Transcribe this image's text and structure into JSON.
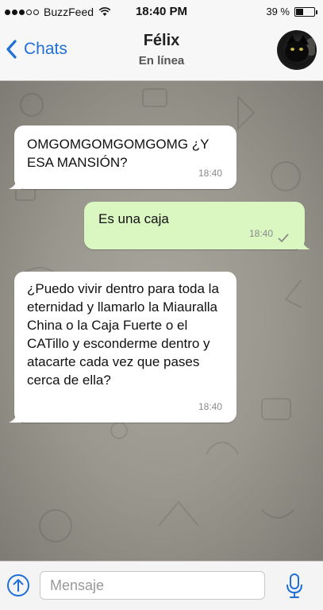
{
  "status_bar": {
    "carrier": "BuzzFeed",
    "time": "18:40 PM",
    "battery_text": "39 %",
    "battery_level": 0.39,
    "signal_bars_filled": 3,
    "signal_bars_total": 5
  },
  "nav": {
    "back_label": "Chats",
    "contact_name": "Félix",
    "contact_status": "En línea"
  },
  "messages": [
    {
      "direction": "incoming",
      "text": "OMGOMGOMGOMGOMG ¿Y ESA MANSIÓN?",
      "time": "18:40"
    },
    {
      "direction": "outgoing",
      "text": "Es una caja",
      "time": "18:40",
      "read_icon": "check-icon"
    },
    {
      "direction": "incoming",
      "text": "¿Puedo vivir dentro para toda la eternidad y llamarlo la Miauralla China o la Caja Fuerte o el CATillo y esconderme dentro y atacarte cada vez que pases cerca de ella?",
      "time": "18:40"
    }
  ],
  "input": {
    "placeholder": "Mensaje",
    "value": ""
  },
  "icons": {
    "back": "chevron-left-icon",
    "upload": "upload-arrow-icon",
    "mic": "microphone-icon"
  },
  "colors": {
    "accent": "#1f6fd6",
    "incoming_bubble": "#ffffff",
    "outgoing_bubble": "#daf7c2",
    "chat_background": "#9a988e"
  }
}
